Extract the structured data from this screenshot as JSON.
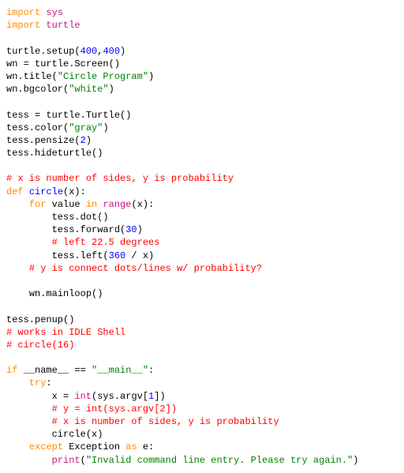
{
  "tokens": {
    "kw_import1": "import",
    "sys": "sys",
    "kw_import2": "import",
    "turtle": "turtle",
    "setup_call": "turtle.setup",
    "lp": "(",
    "rp": ")",
    "n400a": "400",
    "comma": ",",
    "n400b": "400",
    "wn_eq": "wn = ",
    "screen_call": "turtle.Screen",
    "empty_args": "()",
    "wn_title": "wn.title",
    "str_circle_program": "\"Circle Program\"",
    "wn_bg": "wn.bgcolor",
    "str_white": "\"white\"",
    "tess_eq": "tess = ",
    "turtle_Turtle": "turtle.Turtle",
    "tess_color": "tess.color",
    "str_gray": "\"gray\"",
    "tess_pensize": "tess.pensize",
    "n2": "2",
    "tess_hide": "tess.hideturtle",
    "cmt_xyprob": "# x is number of sides, y is probability",
    "kw_def": "def",
    "circle_name": "circle",
    "param_x": "(x):",
    "kw_for": "for",
    "value_in_range": " value ",
    "kw_in": "in",
    "range_call": "range",
    "x_arg": "(x):",
    "tess_dot": "tess.dot()",
    "tess_forward": "tess.forward",
    "n30": "30",
    "cmt_left225": "# left 22.5 degrees",
    "tess_left": "tess.left",
    "n360": "360",
    "div_x": " / x)",
    "cmt_yconnect": "# y is connect dots/lines w/ probability?",
    "wn_mainloop": "wn.mainloop()",
    "tess_penup": "tess.penup()",
    "cmt_idle": "# works in IDLE Shell",
    "cmt_circle16": "# circle(16)",
    "kw_if": "if",
    "name_dunder": " __name__ == ",
    "str_main": "\"__main__\"",
    "colon": ":",
    "kw_try": "try",
    "try_colon": ":",
    "x_eq": "x = ",
    "int_call": "int",
    "sys_argv1": "(sys.argv[",
    "n1": "1",
    "close_idx": "])",
    "cmt_y_int": "# y = int(sys.argv[2])",
    "cmt_x_sides": "# x is number of sides, y is probability",
    "circle_x": "circle(x)",
    "kw_except": "except",
    "exception": " Exception ",
    "kw_as": "as",
    "e_colon": " e:",
    "print_call": "print",
    "str_invalid": "\"Invalid command line entry. Please try again.\""
  }
}
